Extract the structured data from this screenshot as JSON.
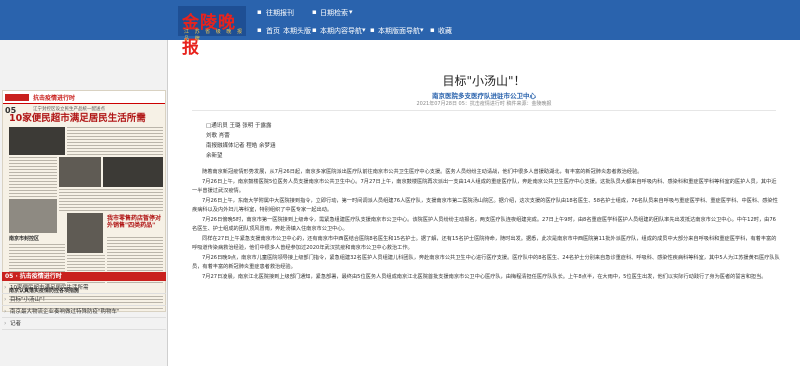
{
  "header": {
    "logo_text": "金陵晚报",
    "logo_sub": "江 苏 省 级 晚 报 品 牌",
    "nav": {
      "past": "往期报刊",
      "date_search": "日期检索",
      "home": "首页",
      "this_issue_front": "本期头版",
      "this_issue_content": "本期内容导航",
      "this_page_nav": "本期版面导航",
      "favorite": "收藏"
    }
  },
  "left": {
    "newspaper": {
      "topic_label": "抗击疫情进行时",
      "page_no": "05",
      "kicker": "江宁封控区设立民生产品统一配送点",
      "headline": "10家便民超市满足居民生活所需",
      "sub_head_1": "南京市封控区",
      "sub_head_2": "我市零售药店暂停对外销售\"四类药品\"",
      "sub_head_3": "南京认真落实疫情防控各项措施"
    },
    "section_label": "05 · 抗击疫情进行时",
    "articles": [
      "10家便民超市满足居民生活所需",
      "目标\"小汤山\"！",
      "南京最大物流企业奏响做过特殊防疫\"购物车\"",
      "记者"
    ]
  },
  "article": {
    "title": "目标\"小汤山\"！",
    "subtitle": "南京医院多支医疗队进驻市公卫中心",
    "meta": "2021年07月28日   05：抗击疫情进行时   稿件来源：金陵晚报",
    "byline": [
      "□通讯员  王璐  张明  于露露",
      "刘歌  肖蕾",
      "南报融媒体记者  程皓  余梦涵",
      "余新望"
    ],
    "paragraphs": [
      "随着南京新冠疫情形势发展，从7月26日起，南京多家医院派出医疗队前往南京市公共卫生医疗中心支援。医务人员纷纷主动请战，他们中很多人曾援助湖北，有丰富的新冠肺炎患者救治经验。",
      "7月26日上午，南京鼓楼医院5位医务人员支援南京市公共卫生中心。7月27日上午，南京鼓楼医院再次派出一支由14人组成的重症医疗队，奔赴南京公共卫生医疗中心支援。这批队员大都来自呼吸内科、感染科和重症医学科等科室的医护人员，其中近一半曾援过武汉疫情。",
      "7月26日上午，东南大学附属中大医院接到指令，立即行动，第一时间调派人员组建76人医疗队，支援南京市第二医院汤山院区。据介绍，这次支援的医疗队由18名医生、58名护士组成，76名队员来自呼吸与重症医学科、重症医学科、中医科、感染性疾病科以及内外妇儿等科室，特别组织了中医专家一起出动。",
      "7月26日傍晚5时，南京市第一医院接到上级命令，需紧急组建医疗队支援南京市公卫中心。该院医护人员纷纷主动报名，两支医疗队连夜组建完成。27日上午9时，由8名重症医学科医护人员组建的团队率先出发抵达南京市公卫中心。中午12时，由76名医生、护士组成的团队顶风冒雨，奔赴汤镇入住南京市公卫中心。",
      "同样在27日上午紧急支援南京市公卫中心的，还有南京市中西医结合医院8名医生和15名护士。据了解，还有15名护士医院待命，随时出发。据悉，此次是南京市中西医院第11批外派医疗队，组成的成员中大部分来自呼吸科和重症医学科，有着丰富的呼吸道传染病救治经验，他们中很多人曾经参加过2020年武汉抗疫和南京市公卫中心救治工作。",
      "7月26日晚9点，南京市儿童医院领导接上级部门指令，紧急组建32名医护人员组建儿科团队，奔赴南京市公共卫生中心进行医疗支援。医疗队中的8名医生、24名护士分别来自急诊重症科、呼吸科、感染性疾病科等科室，其中5人为江苏援黄石医疗队队员，有着丰富的新冠肺炎重症患者救治经验。",
      "7月27日凌晨，南京江北医院接到上级部门通知，紧急部署，最终由5位医务人员组成南京江北医院首批支援南京市公卫中心医疗队，由梅程清担任医疗队队长。上午8点半，在大雨中，5位医生出发，他们以实际行动践行了身为医者的誓言和担当。"
    ]
  },
  "colors": {
    "header_bg": "#2a63ad",
    "logo_red": "#e8231d",
    "section_red": "#c9211e",
    "subtitle_blue": "#2a63ad"
  }
}
